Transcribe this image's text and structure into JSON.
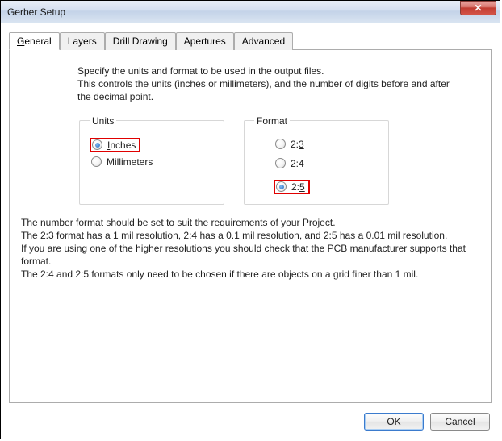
{
  "window": {
    "title": "Gerber Setup"
  },
  "tabs": [
    {
      "label": "General"
    },
    {
      "label": "Layers"
    },
    {
      "label": "Drill Drawing"
    },
    {
      "label": "Apertures"
    },
    {
      "label": "Advanced"
    }
  ],
  "intro": {
    "line1": "Specify the units and format to be used in the output files.",
    "line2": "This controls the units (inches or millimeters), and the number of digits before and after the decimal point."
  },
  "units": {
    "legend": "Units",
    "inches": "Inches",
    "millimeters": "Millimeters",
    "selected": "inches"
  },
  "format": {
    "legend": "Format",
    "o23": "2:3",
    "o24": "2:4",
    "o25": "2:5",
    "selected": "2:5"
  },
  "explain": {
    "p1": "The number format should be set to suit the requirements of your Project.",
    "p2": "The 2:3 format has a 1 mil resolution, 2:4 has a 0.1 mil resolution, and 2:5 has a 0.01 mil resolution.",
    "p3": "If you are using one of the higher resolutions you should check that the PCB manufacturer supports that format.",
    "p4": "The 2:4 and 2:5 formats only need to be chosen if there are objects on a grid finer than 1 mil."
  },
  "buttons": {
    "ok": "OK",
    "cancel": "Cancel"
  }
}
